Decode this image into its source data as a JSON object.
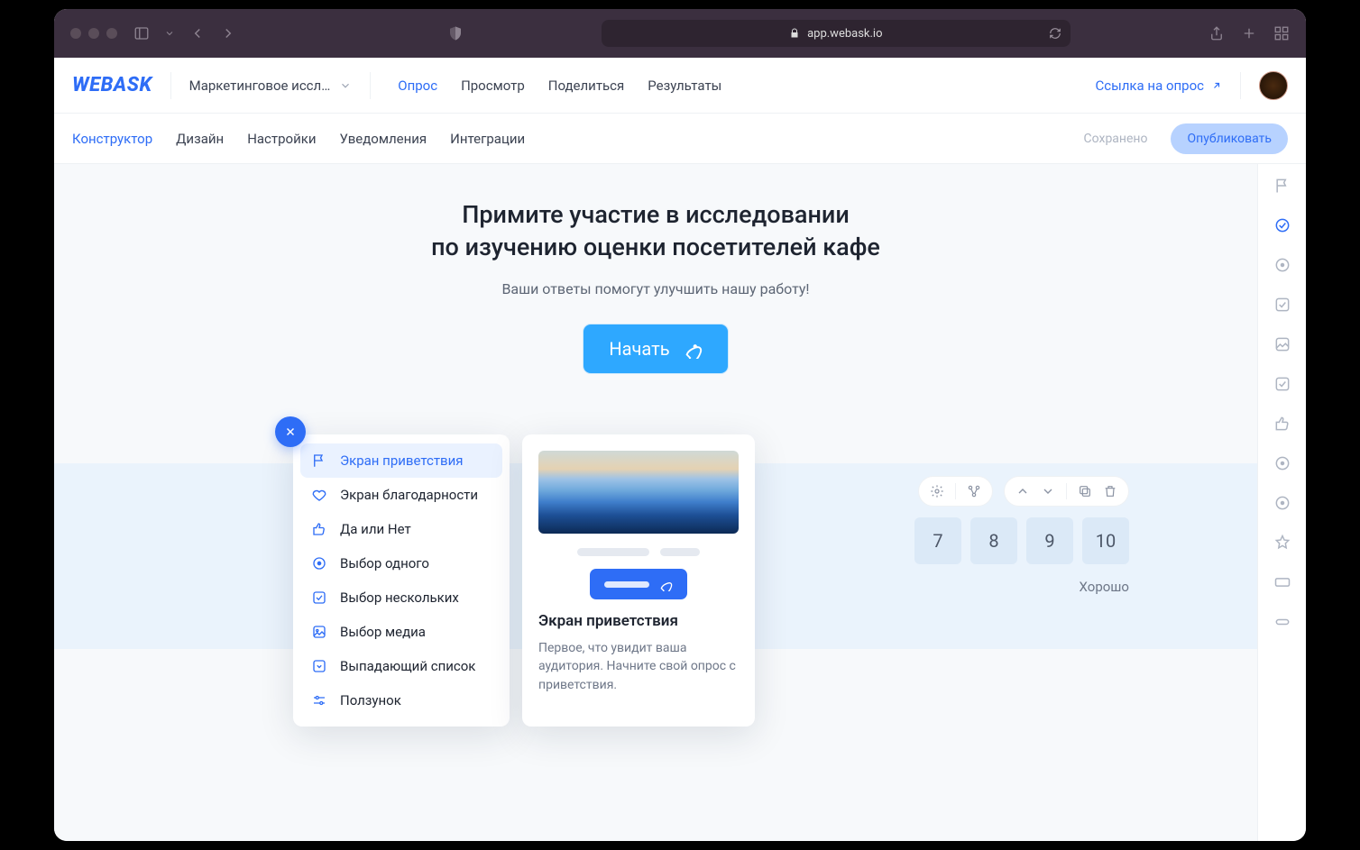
{
  "browser": {
    "url": "app.webask.io"
  },
  "header": {
    "logo_text": "WEBASK",
    "project_name": "Маркетинговое иссл…",
    "tabs": [
      "Опрос",
      "Просмотр",
      "Поделиться",
      "Результаты"
    ],
    "active_tab_index": 0,
    "survey_link_label": "Ссылка на опрос"
  },
  "subheader": {
    "tabs": [
      "Конструктор",
      "Дизайн",
      "Настройки",
      "Уведомления",
      "Интеграции"
    ],
    "active_tab_index": 0,
    "saved_label": "Сохранено",
    "publish_label": "Опубликовать"
  },
  "hero": {
    "title_line1": "Примите участие в исследовании",
    "title_line2": "по изучению оценки посетителей кафе",
    "subtitle": "Ваши ответы помогут улучшить нашу работу!",
    "start_label": "Начать"
  },
  "question": {
    "scale_visible": [
      "7",
      "8",
      "9",
      "10"
    ],
    "label_right": "Хорошо"
  },
  "popover": {
    "menu": [
      "Экран приветствия",
      "Экран благодарности",
      "Да или Нет",
      "Выбор одного",
      "Выбор нескольких",
      "Выбор медиа",
      "Выпадающий список",
      "Ползунок"
    ],
    "active_index": 0,
    "preview_title": "Экран приветствия",
    "preview_desc": "Первое, что увидит ваша аудитория. Начните свой опрос с приветствия."
  },
  "rightrail": {
    "items": [
      "flag-icon",
      "target-icon",
      "radio-icon",
      "checkbox-icon",
      "image-icon",
      "checkbox2-icon",
      "thumb-icon",
      "radio2-icon",
      "radio3-icon",
      "star-icon",
      "card-icon",
      "pill-icon"
    ],
    "active_index": 1
  }
}
